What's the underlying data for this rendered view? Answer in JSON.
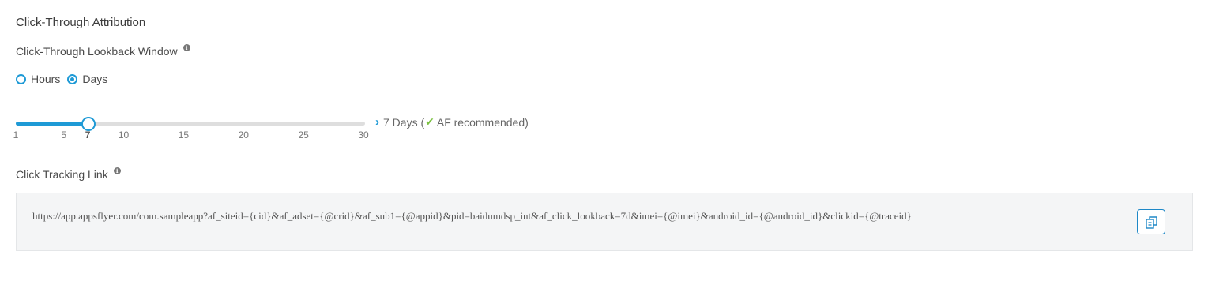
{
  "section": {
    "title": "Click-Through Attribution"
  },
  "lookback": {
    "label": "Click-Through Lookback Window",
    "info_icon": "info-icon",
    "options": [
      {
        "label": "Hours",
        "selected": false
      },
      {
        "label": "Days",
        "selected": true
      }
    ],
    "slider": {
      "min": 1,
      "max": 30,
      "value": 7,
      "ticks": [
        "1",
        "5",
        "7",
        "10",
        "15",
        "20",
        "25",
        "30"
      ],
      "fill_color": "#1e9ad6"
    },
    "value_prefix": "7 Days (",
    "value_recommendation": "AF recommended)",
    "chevron_icon": "chevron-right-icon",
    "check_icon": "check-icon"
  },
  "tracking": {
    "label": "Click Tracking Link",
    "info_icon": "info-icon",
    "url": "https://app.appsflyer.com/com.sampleapp?af_siteid={cid}&af_adset={@crid}&af_sub1={@appid}&pid=baidumdsp_int&af_click_lookback=7d&imei={@imei}&android_id={@android_id}&clickid={@traceid}",
    "copy_icon": "copy-icon"
  },
  "colors": {
    "accent": "#1e9ad6",
    "success": "#7bc142"
  }
}
